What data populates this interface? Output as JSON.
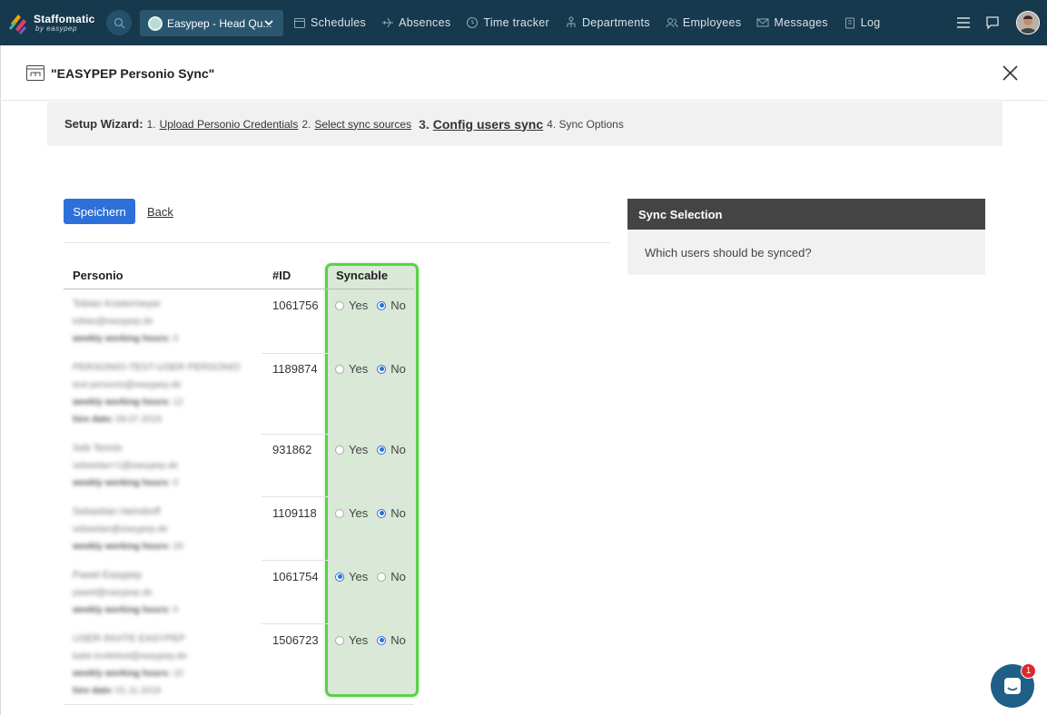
{
  "app": {
    "brand_name": "Staffomatic",
    "brand_sub": "by easypep",
    "location": "Easypep - Head Qu...",
    "nav": [
      {
        "label": "Schedules",
        "icon": "calendar-icon"
      },
      {
        "label": "Absences",
        "icon": "plane-icon"
      },
      {
        "label": "Time tracker",
        "icon": "clock-icon"
      },
      {
        "label": "Departments",
        "icon": "departments-icon"
      },
      {
        "label": "Employees",
        "icon": "users-icon"
      },
      {
        "label": "Messages",
        "icon": "envelope-icon"
      },
      {
        "label": "Log",
        "icon": "clipboard-icon"
      }
    ]
  },
  "modal": {
    "title": "\"EASYPEP Personio Sync\""
  },
  "wizard": {
    "label": "Setup Wizard:",
    "step1_num": "1.",
    "step1": "Upload Personio Credentials",
    "step2_num": "2.",
    "step2": "Select sync sources",
    "step3_num": "3.",
    "step3": "Config users sync",
    "step4": "4. Sync Options"
  },
  "actions": {
    "save": "Speichern",
    "back": "Back"
  },
  "table": {
    "headers": {
      "personio": "Personio",
      "id": "#ID",
      "syncable": "Syncable"
    },
    "yes": "Yes",
    "no": "No",
    "rows": [
      {
        "name": "Tobias Küstermeyer",
        "email": "tobias@easypep.de",
        "hours_label": "weekly working hours:",
        "hours": "0",
        "id": "1061756",
        "syncable": "No"
      },
      {
        "name": "PERSONIO-TEST-USER PERSONIO",
        "email": "test-personio@easypep.de",
        "hours_label": "weekly working hours:",
        "hours": "12",
        "hire_label": "hire date:",
        "hire": "09.07.2019",
        "id": "1189874",
        "syncable": "No"
      },
      {
        "name": "Seb Tennis",
        "email": "sebastian+1@easypep.de",
        "hours_label": "weekly working hours:",
        "hours": "0",
        "id": "931862",
        "syncable": "No"
      },
      {
        "name": "Sebastian Heindorff",
        "email": "sebastian@easypep.de",
        "hours_label": "weekly working hours:",
        "hours": "20",
        "id": "1109118",
        "syncable": "No"
      },
      {
        "name": "Pawel Easypep",
        "email": "pawel@easypep.de",
        "hours_label": "weekly working hours:",
        "hours": "0",
        "id": "1061754",
        "syncable": "Yes"
      },
      {
        "name": "USER-INVITE EASYPEP",
        "email": "katie-invitetest@easypep.de",
        "hours_label": "weekly working hours:",
        "hours": "10",
        "hire_label": "hire date:",
        "hire": "01.11.2019",
        "id": "1506723",
        "syncable": "No"
      }
    ]
  },
  "sync_panel": {
    "title": "Sync Selection",
    "question": "Which users should be synced?"
  },
  "chat": {
    "badge": "1"
  }
}
